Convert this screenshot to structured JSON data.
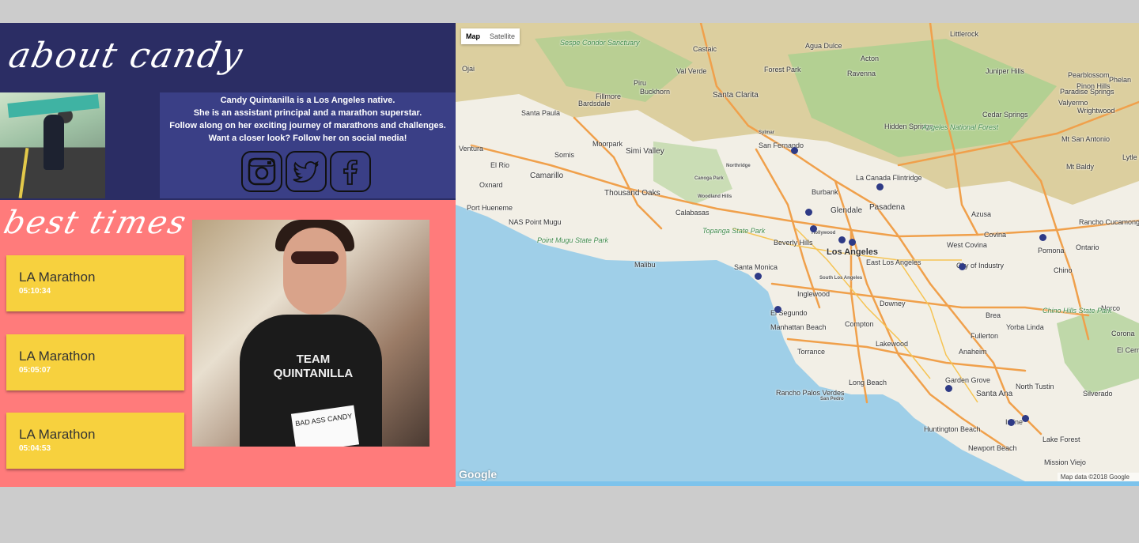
{
  "about": {
    "title": "about candy",
    "bio_lines": [
      "Candy Quintanilla is a Los Angeles native.",
      "She is an assistant principal and a marathon superstar.",
      "Follow along on her exciting journey of marathons and challenges.",
      "Want a closer look? Follow her on social media!"
    ],
    "social": [
      "instagram-icon",
      "twitter-icon",
      "facebook-icon"
    ]
  },
  "best_times": {
    "title": "best times",
    "races": [
      {
        "name": "LA Marathon",
        "time": "05:10:34"
      },
      {
        "name": "LA Marathon",
        "time": "05:05:07"
      },
      {
        "name": "LA Marathon",
        "time": "05:04:53"
      }
    ],
    "photo_text": [
      "TEAM",
      "QUINTANILLA",
      "BAD ASS CANDY"
    ]
  },
  "map": {
    "type_controls": [
      "Map",
      "Satellite"
    ],
    "active_type": "Map",
    "google_logo": "Google",
    "attribution": "Map data ©2018 Google",
    "colors": {
      "water": "#9fcfe8",
      "land": "#f2efe6",
      "hills": "#dccf9f",
      "park": "#a9cf8e",
      "highway": "#f0a04b",
      "marker": "#2e3a86"
    },
    "places": [
      "Sespe Condor Sanctuary",
      "Castaic",
      "Agua Dulce",
      "Littlerock",
      "Acton",
      "Ravenna",
      "Val Verde",
      "Piru",
      "Fillmore",
      "Buckhorn",
      "Forest Park",
      "Juniper Hills",
      "Pearblossom",
      "Pinon Hills",
      "Phelan",
      "Ojai",
      "Santa Clarita",
      "Bardsdale",
      "Santa Paula",
      "Paradise Springs",
      "Valyermo",
      "Wrightwood",
      "Hidden Springs",
      "Angeles National Forest",
      "Cedar Springs",
      "Mt San Antonio",
      "Ventura",
      "Somis",
      "Moorpark",
      "Simi Valley",
      "Sylmar",
      "San Fernando",
      "Mt Baldy",
      "Lytle Creek",
      "El Rio",
      "Camarillo",
      "Northridge",
      "La Canada Flintridge",
      "Oxnard",
      "Canoga Park",
      "Thousand Oaks",
      "Woodland Hills",
      "Burbank",
      "Pasadena",
      "Port Hueneme",
      "Calabasas",
      "Glendale",
      "Azusa",
      "Rancho Cucamonga",
      "NAS Point Mugu",
      "Topanga State Park",
      "Hollywood",
      "Covina",
      "Point Mugu State Park",
      "Beverly Hills",
      "West Covina",
      "Pomona",
      "Ontario",
      "Malibu",
      "Los Angeles",
      "City of Industry",
      "Chino",
      "Santa Monica",
      "East Los Angeles",
      "South Los Angeles",
      "Inglewood",
      "Downey",
      "Norco",
      "El Segundo",
      "Brea",
      "Chino Hills State Park",
      "Manhattan Beach",
      "Compton",
      "Yorba Linda",
      "Corona",
      "Lakewood",
      "Fullerton",
      "Torrance",
      "Anaheim",
      "El Cerrito",
      "Long Beach",
      "Garden Grove",
      "North Tustin",
      "Rancho Palos Verdes",
      "San Pedro",
      "Silverado",
      "Santa Ana",
      "Irvine",
      "Huntington Beach",
      "Lake Forest",
      "Newport Beach",
      "Mission Viejo"
    ]
  }
}
